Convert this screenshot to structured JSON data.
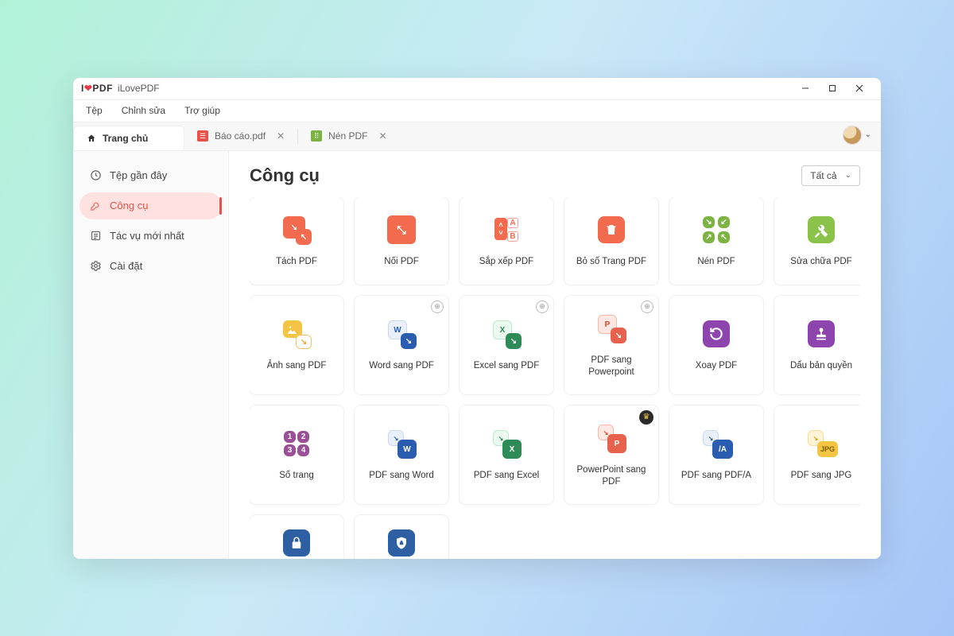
{
  "titlebar": {
    "app_name": "iLovePDF"
  },
  "menubar": {
    "file": "Tệp",
    "edit": "Chỉnh sửa",
    "help": "Trợ giúp"
  },
  "tabs": {
    "home": "Trang chủ",
    "doc1": "Báo cáo.pdf",
    "doc2": "Nén PDF"
  },
  "sidebar": {
    "recent": "Tệp gần đây",
    "tools": "Công cụ",
    "tasks": "Tác vụ mới nhất",
    "settings": "Cài đặt"
  },
  "main": {
    "title": "Công cụ",
    "filter": "Tất cả"
  },
  "tools": {
    "split": "Tách PDF",
    "merge": "Nối PDF",
    "organize": "Sắp xếp PDF",
    "remove_pages": "Bỏ số Trang PDF",
    "compress": "Nén PDF",
    "repair": "Sửa chữa PDF",
    "img2pdf": "Ảnh sang PDF",
    "word2pdf": "Word sang PDF",
    "excel2pdf": "Excel sang PDF",
    "pdf2ppt": "PDF sang Powerpoint",
    "rotate": "Xoay PDF",
    "watermark": "Dấu bản quyền",
    "pagenum": "Số trang",
    "pdf2word": "PDF sang Word",
    "pdf2excel": "PDF sang Excel",
    "ppt2pdf": "PowerPoint sang PDF",
    "pdf2pdfa": "PDF sang PDF/A",
    "pdf2jpg": "PDF sang JPG"
  },
  "letters": {
    "W": "W",
    "X": "X",
    "P": "P",
    "A": "A",
    "B": "B",
    "JPG": "JPG",
    "slashA": "/A",
    "n1": "1",
    "n2": "2",
    "n3": "3",
    "n4": "4"
  }
}
